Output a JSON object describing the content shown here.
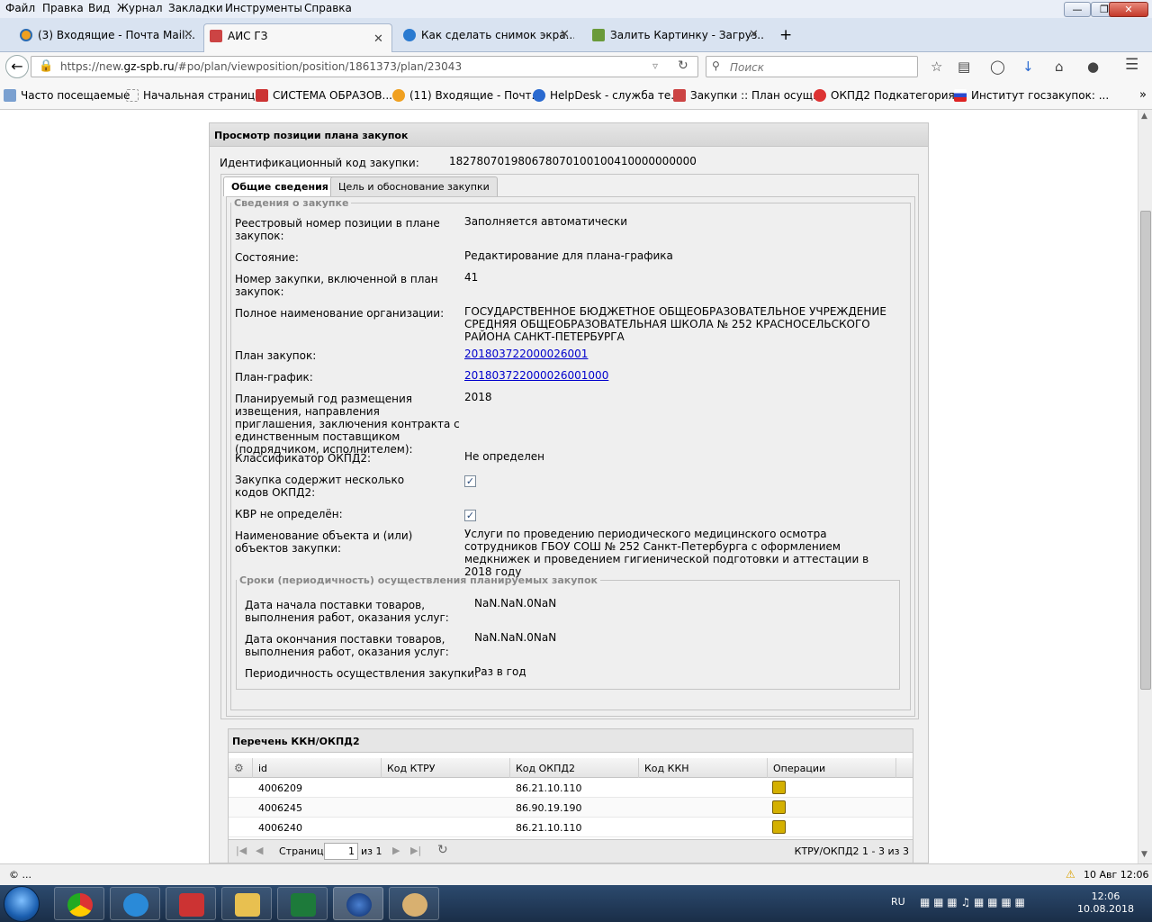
{
  "menu": [
    "Файл",
    "Правка",
    "Вид",
    "Журнал",
    "Закладки",
    "Инструменты",
    "Справка"
  ],
  "tabs": [
    {
      "label": "(3) Входящие - Почта Mail...",
      "active": false
    },
    {
      "label": "АИС ГЗ",
      "active": true
    },
    {
      "label": "Как сделать снимок экра...",
      "active": false
    },
    {
      "label": "Залить Картинку - Загруз...",
      "active": false
    }
  ],
  "new_tab": "+",
  "nav": {
    "url_prefix": "https://new.",
    "url_domain": "gz-spb.ru",
    "url_path": "/#po/plan/viewposition/position/1861373/plan/23043",
    "search_placeholder": "Поиск"
  },
  "bookmarks": [
    "Часто посещаемые",
    "Начальная страница",
    "СИСТЕМА ОБРАЗОВ...",
    "(11) Входящие - Почт...",
    "HelpDesk - служба те...",
    "Закупки :: План осущ...",
    "ОКПД2 Подкатегория...",
    "Институт госзакупок: ..."
  ],
  "page": {
    "title": "Просмотр позиции плана закупок",
    "id_label": "Идентификационный код закупки:",
    "id_value": "182780701980678070100100410000000000",
    "tab_general": "Общие сведения",
    "tab_goal": "Цель и обоснование закупки",
    "fieldset_info": "Сведения о закупке",
    "fields": {
      "reg_num_label": "Реестровый номер позиции в плане закупок:",
      "reg_num_value": "Заполняется автоматически",
      "state_label": "Состояние:",
      "state_value": "Редактирование для плана-графика",
      "num_label": "Номер закупки, включенной в план закупок:",
      "num_value": "41",
      "org_label": "Полное наименование организации:",
      "org_value": "ГОСУДАРСТВЕННОЕ БЮДЖЕТНОЕ ОБЩЕОБРАЗОВАТЕЛЬНОЕ УЧРЕЖДЕНИЕ СРЕДНЯЯ ОБЩЕОБРАЗОВАТЕЛЬНАЯ ШКОЛА № 252 КРАСНОСЕЛЬСКОГО РАЙОНА САНКТ-ПЕТЕРБУРГА",
      "plan_label": "План закупок:",
      "plan_value": "201803722000026001",
      "schedule_label": "План-график:",
      "schedule_value": "201803722000026001000",
      "year_label": "Планируемый год размещения извещения, направления приглашения, заключения контракта с единственным поставщиком (подрядчиком, исполнителем):",
      "year_value": "2018",
      "okpd_label": "Классификатор ОКПД2:",
      "okpd_value": "Не определен",
      "multi_label": "Закупка содержит несколько кодов ОКПД2:",
      "kvr_label": "КВР не определён:",
      "object_label": "Наименование объекта и (или) объектов закупки:",
      "object_value": "Услуги по проведению периодического медицинского осмотра сотрудников ГБОУ СОШ № 252 Санкт-Петербурга с оформлением медкнижек и проведением гигиенической подготовки и аттестации в 2018 году"
    },
    "fieldset_terms": "Сроки (периодичность) осуществления планируемых закупок",
    "terms": {
      "start_label": "Дата начала поставки товаров, выполнения работ, оказания услуг:",
      "start_value": "NaN.NaN.0NaN",
      "end_label": "Дата окончания поставки товаров, выполнения работ, оказания услуг:",
      "end_value": "NaN.NaN.0NaN",
      "period_label": "Периодичность осуществления закупки:",
      "period_value": "Раз в год"
    },
    "grid": {
      "title": "Перечень ККН/ОКПД2",
      "columns": [
        "id",
        "Код КТРУ",
        "Код ОКПД2",
        "Код ККН",
        "Операции"
      ],
      "rows": [
        {
          "id": "4006209",
          "ktru": "",
          "okpd": "86.21.10.110",
          "kkn": ""
        },
        {
          "id": "4006245",
          "ktru": "",
          "okpd": "86.90.19.190",
          "kkn": ""
        },
        {
          "id": "4006240",
          "ktru": "",
          "okpd": "86.21.10.110",
          "kkn": ""
        }
      ],
      "pager_page_label": "Страница",
      "pager_page": "1",
      "pager_of": "из 1",
      "pager_summary": "КТРУ/ОКПД2 1 - 3 из 3"
    }
  },
  "status": {
    "left": "© ...",
    "right": "10 Авг 12:06"
  },
  "taskbar": {
    "lang": "RU",
    "time": "12:06",
    "date": "10.08.2018"
  }
}
